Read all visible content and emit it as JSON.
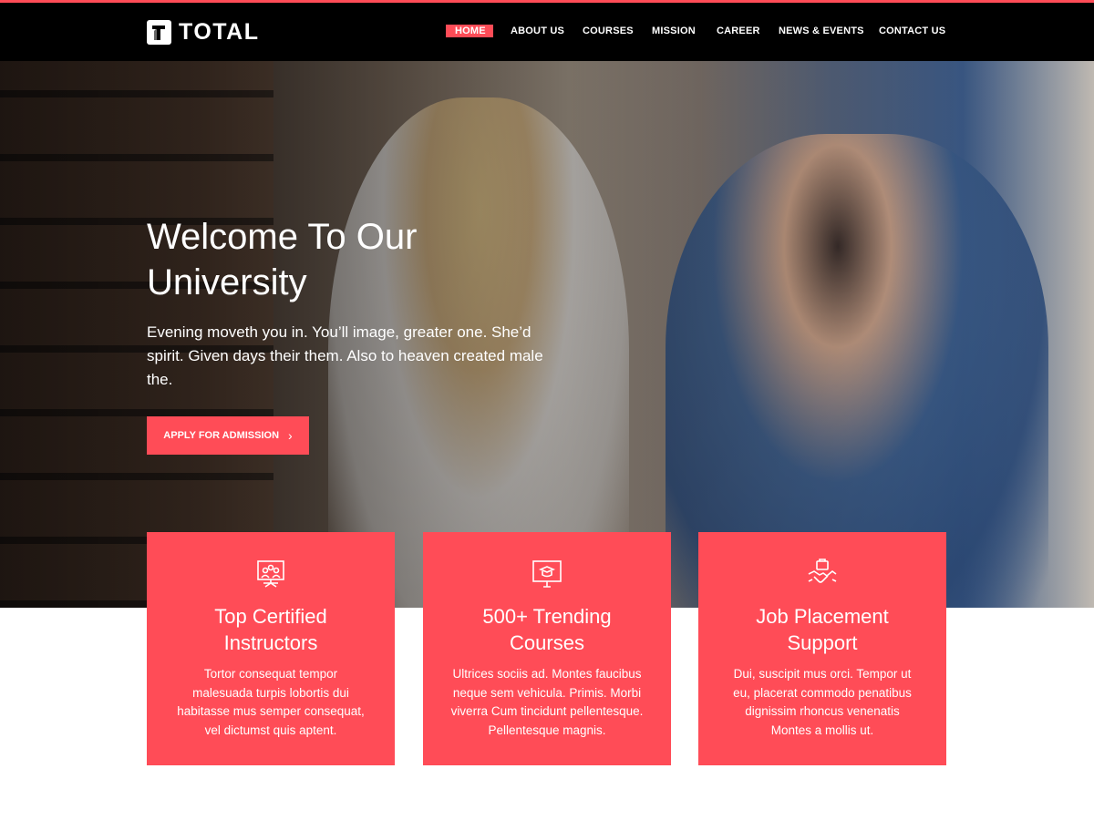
{
  "brand": {
    "name": "TOTAL",
    "accent": "#ff4c57",
    "nav_bg": "#000000"
  },
  "nav": {
    "items": [
      {
        "label": "HOME",
        "active": true
      },
      {
        "label": "ABOUT US",
        "active": false
      },
      {
        "label": "COURSES",
        "active": false
      },
      {
        "label": "MISSION",
        "active": false
      },
      {
        "label": "CAREER",
        "active": false
      },
      {
        "label": "NEWS & EVENTS",
        "active": false
      },
      {
        "label": "CONTACT US",
        "active": false
      }
    ]
  },
  "hero": {
    "title_line1": "Welcome To Our",
    "title_line2": "University",
    "text": "Evening moveth you in. You’ll image, greater one. She’d spirit. Given days their them. Also to heaven created male the.",
    "cta_label": "APPLY FOR ADMISSION"
  },
  "features": [
    {
      "icon": "presentation-icon",
      "title_line1": "Top Certified",
      "title_line2": "Instructors",
      "desc": "Tortor consequat tempor malesuada turpis lobortis dui habitasse mus semper consequat, vel dictumst quis aptent."
    },
    {
      "icon": "graduation-monitor-icon",
      "title_line1": "500+ Trending",
      "title_line2": "Courses",
      "desc": "Ultrices sociis ad. Montes faucibus neque sem vehicula. Primis. Morbi viverra Cum tincidunt pellentesque. Pellentesque magnis."
    },
    {
      "icon": "handshake-briefcase-icon",
      "title_line1": "Job Placement",
      "title_line2": "Support",
      "desc": "Dui, suscipit mus orci. Tempor ut eu, placerat commodo penatibus dignissim rhoncus venenatis Montes a mollis ut."
    }
  ]
}
